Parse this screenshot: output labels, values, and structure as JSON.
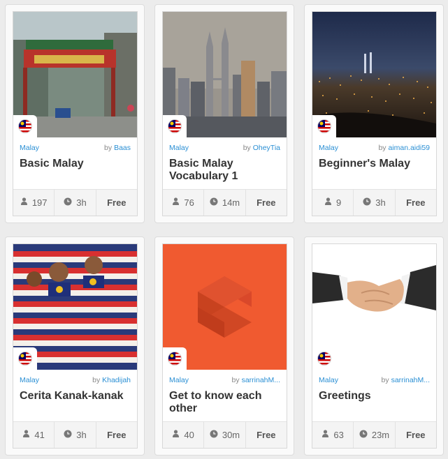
{
  "courses": [
    {
      "language": "Malay",
      "by": "by",
      "author": "Baas",
      "title": "Basic Malay",
      "learners": "197",
      "duration": "3h",
      "price": "Free",
      "image": "street-gate"
    },
    {
      "language": "Malay",
      "by": "by",
      "author": "OheyTia",
      "title": "Basic Malay Vocabulary 1",
      "learners": "76",
      "duration": "14m",
      "price": "Free",
      "image": "city-skyline"
    },
    {
      "language": "Malay",
      "by": "by",
      "author": "aiman.aidi59",
      "title": "Beginner's Malay",
      "learners": "9",
      "duration": "3h",
      "price": "Free",
      "image": "night-city"
    },
    {
      "language": "Malay",
      "by": "by",
      "author": "Khadijah",
      "title": "Cerita Kanak-kanak",
      "learners": "41",
      "duration": "3h",
      "price": "Free",
      "image": "children-flags"
    },
    {
      "language": "Malay",
      "by": "by",
      "author": "sarrinahM...",
      "title": "Get to know each other",
      "learners": "40",
      "duration": "30m",
      "price": "Free",
      "image": "orange-logo"
    },
    {
      "language": "Malay",
      "by": "by",
      "author": "sarrinahM...",
      "title": "Greetings",
      "learners": "63",
      "duration": "23m",
      "price": "Free",
      "image": "handshake"
    }
  ],
  "colors": {
    "link": "#2a8fd4",
    "orange": "#f05a30"
  }
}
